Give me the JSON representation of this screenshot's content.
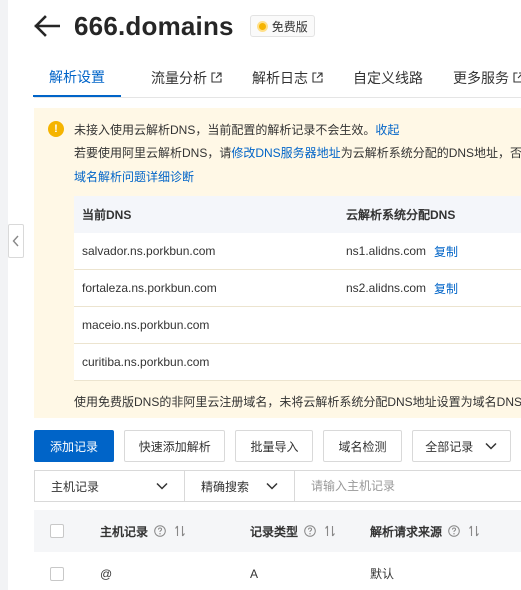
{
  "header": {
    "title": "666.domains",
    "badge": "免费版"
  },
  "tabs": [
    {
      "label": "解析设置",
      "active": true,
      "external": false
    },
    {
      "label": "流量分析",
      "active": false,
      "external": true
    },
    {
      "label": "解析日志",
      "active": false,
      "external": true
    },
    {
      "label": "自定义线路",
      "active": false,
      "external": false
    },
    {
      "label": "更多服务",
      "active": false,
      "external": true
    }
  ],
  "notice": {
    "line1": "未接入使用云解析DNS，当前配置的解析记录不会生效。",
    "collapse_link": "收起",
    "line2_prefix": "若要使用阿里云解析DNS，请",
    "line2_link": "修改DNS服务器地址",
    "line2_suffix": "为云解析系统分配的DNS地址，否则",
    "diagnose_link": "域名解析问题详细诊断",
    "table": {
      "col_current": "当前DNS",
      "col_assigned": "云解析系统分配DNS",
      "rows": [
        {
          "current": "salvador.ns.porkbun.com",
          "assigned": "ns1.alidns.com",
          "copy": "复制"
        },
        {
          "current": "fortaleza.ns.porkbun.com",
          "assigned": "ns2.alidns.com",
          "copy": "复制"
        },
        {
          "current": "maceio.ns.porkbun.com",
          "assigned": "",
          "copy": ""
        },
        {
          "current": "curitiba.ns.porkbun.com",
          "assigned": "",
          "copy": ""
        }
      ]
    },
    "footer": "使用免费版DNS的非阿里云注册域名，未将云解析系统分配DNS地址设置为域名DNS服"
  },
  "toolbar": {
    "add_record": "添加记录",
    "quick_add": "快速添加解析",
    "bulk_import": "批量导入",
    "domain_check": "域名检测",
    "all_records": "全部记录"
  },
  "filters": {
    "field_select": "主机记录",
    "match_select": "精确搜索",
    "search_placeholder": "请输入主机记录"
  },
  "records_table": {
    "col_host": "主机记录",
    "col_type": "记录类型",
    "col_source": "解析请求来源",
    "rows": [
      {
        "host": "@",
        "type": "A",
        "source": "默认"
      }
    ]
  },
  "colors": {
    "accent": "#0064c8",
    "notice_bg": "#fff8e6",
    "warning": "#f5b400"
  }
}
